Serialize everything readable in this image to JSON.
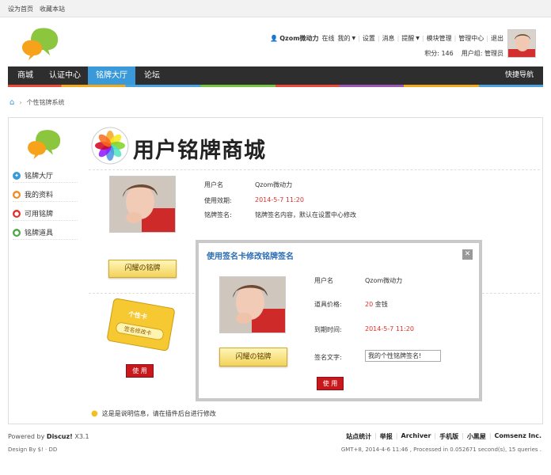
{
  "topbar": {
    "set_home": "设为首页",
    "bookmark": "收藏本站"
  },
  "userbar": {
    "username": "Qzom微动力",
    "online": "在线",
    "mine": "我的",
    "settings": "设置",
    "messages": "消息",
    "reminders": "提醒",
    "module_admin": "模块管理",
    "admin_center": "管理中心",
    "logout": "退出",
    "points": "积分: 146",
    "user_group": "用户组: 管理员"
  },
  "nav": {
    "items": [
      "商城",
      "认证中心",
      "铭牌大厅",
      "论坛"
    ],
    "active_index": 2,
    "quick_nav": "快捷导航"
  },
  "breadcrumb": {
    "current": "个性铭牌系统"
  },
  "sidebar": {
    "items": [
      {
        "label": "铭牌大厅",
        "color": "#3a9ad9",
        "glyph": "✦"
      },
      {
        "label": "我的资料",
        "color": "#f08a24",
        "glyph": "●"
      },
      {
        "label": "可用铭牌",
        "color": "#e0302a",
        "glyph": "●"
      },
      {
        "label": "铭牌道具",
        "color": "#4aa844",
        "glyph": "●"
      }
    ]
  },
  "banner": {
    "title": "用户铭牌商城"
  },
  "profile": {
    "username_label": "用户名",
    "username_value": "Qzom微动力",
    "expire_label": "使用效期:",
    "expire_value": "2014-5-7 11:20",
    "sign_label": "铭牌签名:",
    "sign_value": "铭牌签名内容，默认在设置中心修改",
    "badge_button": "闪耀の铭牌"
  },
  "card": {
    "label_top": "个性卡",
    "label_bottom": "签名修改卡",
    "use_button": "使 用"
  },
  "tip": {
    "text": "这是是说明信息，请在插件后台进行修改"
  },
  "modal": {
    "title": "使用签名卡修改铭牌签名",
    "close": "✕",
    "username_label": "用户名",
    "username_value": "Qzom微动力",
    "price_label": "道具价格:",
    "price_value": "20",
    "price_unit": "金钱",
    "expire_label": "到期时间:",
    "expire_value": "2014-5-7 11:20",
    "sign_label": "签名文字:",
    "sign_input_value": "我的个性铭牌签名!",
    "badge_button": "闪耀の铭牌",
    "use_button": "使 用"
  },
  "footer": {
    "powered_prefix": "Powered by ",
    "powered_brand": "Discuz!",
    "powered_version": " X3.1",
    "design": "Design By $! · DD",
    "links": [
      "站点统计",
      "举报",
      "Archiver",
      "手机版",
      "小黑屋",
      "Comsenz Inc."
    ],
    "stats": "GMT+8, 2014-4-6 11:46 , Processed in 0.052671 second(s), 15 queries ."
  }
}
